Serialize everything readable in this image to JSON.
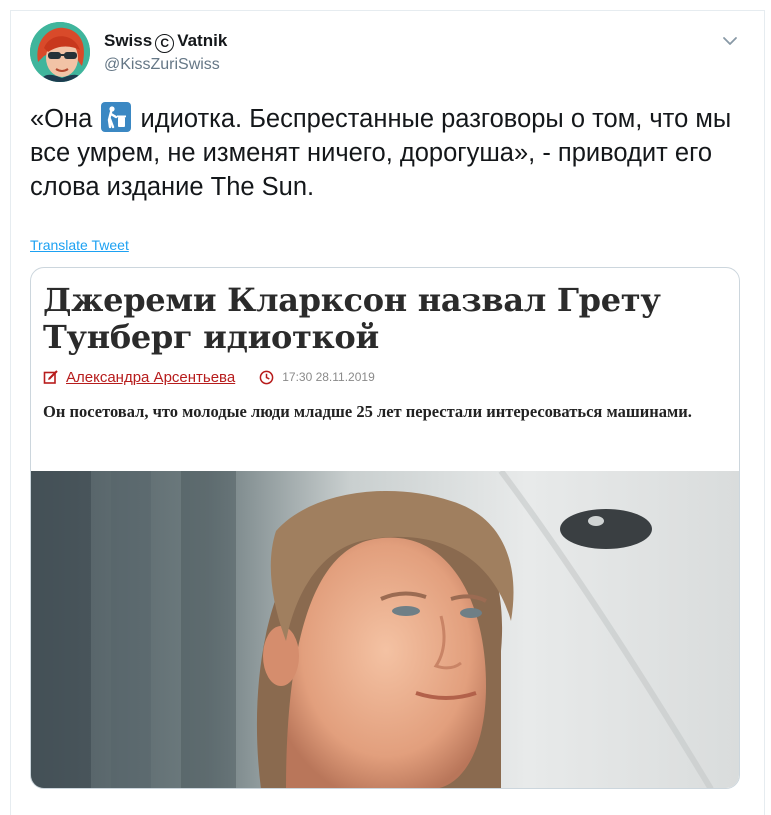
{
  "tweet": {
    "author_name_part1": "Swiss",
    "author_name_symbol": "C",
    "author_name_part2": "Vatnik",
    "handle": "@KissZuriSwiss",
    "text_before_emoji": "«Она",
    "text_after_emoji": " идиотка. Беспрестанные разговоры о том, что мы все умрем,  не изменят ничего, дорогуша», - приводит его слова издание The Sun.",
    "translate_label": "Translate Tweet",
    "icons": {
      "menu": "chevron-down-icon",
      "emoji": "put-litter-in-its-place-icon"
    },
    "accent_color": "#1da1f2"
  },
  "card": {
    "headline": "Джереми Кларксон назвал Грету Тунберг идиоткой",
    "author": "Александра Арсентьева",
    "datetime": "17:30 28.11.2019",
    "lead": "Он посетовал, что молодые люди младше 25 лет перестали интересоваться машинами.",
    "author_color": "#b71c1c",
    "icons": {
      "author": "edit-icon",
      "time": "clock-icon"
    }
  }
}
